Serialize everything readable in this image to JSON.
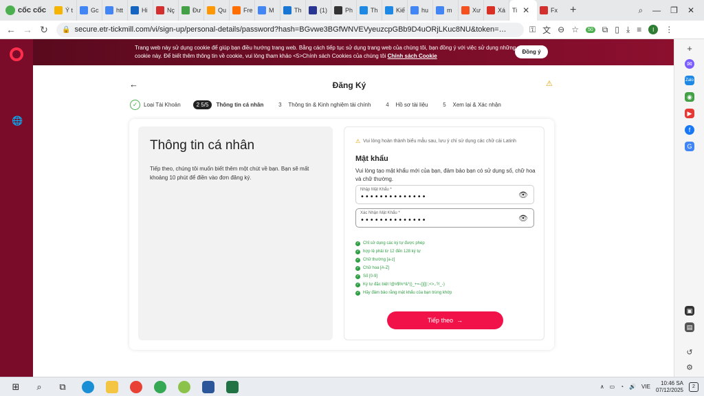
{
  "browser": {
    "name": "cốc cốc",
    "tabs": [
      {
        "label": "Ý t",
        "color": "#f4b400"
      },
      {
        "label": "Gc",
        "color": "#4285f4"
      },
      {
        "label": "htt",
        "color": "#4285f4"
      },
      {
        "label": "Hi",
        "color": "#1565c0"
      },
      {
        "label": "Nç",
        "color": "#d32f2f"
      },
      {
        "label": "Đư",
        "color": "#43a047"
      },
      {
        "label": "Qu",
        "color": "#ff9800"
      },
      {
        "label": "Fre",
        "color": "#ff6f00"
      },
      {
        "label": "M",
        "color": "#4285f4"
      },
      {
        "label": "Th",
        "color": "#1976d2"
      },
      {
        "label": "(1)",
        "color": "#283593"
      },
      {
        "label": "Ph",
        "color": "#333333"
      },
      {
        "label": "Th",
        "color": "#1e88e5"
      },
      {
        "label": "Kiế",
        "color": "#1e88e5"
      },
      {
        "label": "hu",
        "color": "#4285f4"
      },
      {
        "label": "m",
        "color": "#4285f4"
      },
      {
        "label": "Xư",
        "color": "#f4511e"
      },
      {
        "label": "Xá",
        "color": "#d93025"
      }
    ],
    "active_tab": "Ti",
    "tab_after": "Fx",
    "url": "secure.etr-tickmill.com/vi/sign-up/personal-details/password?hash=BGvwe3BGfWNVEVyeuzcpGBb9D4uORjLKuc8NU&token=aDMiWzPpuU0MGlGsWi...",
    "extension_badge": "50",
    "profile_initial": "I"
  },
  "cookie": {
    "text": "Trang web này sử dụng cookie để giúp bạn điều hướng trang web. Bằng cách tiếp tục sử dụng trang web của chúng tôi, bạn đồng ý với việc sử dụng những cookie này. Để biết thêm thông tin về cookie, vui lòng tham khảo <5>Chính sách Cookies của chúng tôi",
    "link": "Chính sách Cookie",
    "accept": "Đồng ý"
  },
  "page": {
    "title": "Đăng Ký",
    "steps": [
      {
        "num": "",
        "label": "Loại Tài Khoản",
        "state": "done"
      },
      {
        "num": "2",
        "extra": "5/5",
        "label": "Thông tin cá nhân",
        "state": "current"
      },
      {
        "num": "3",
        "label": "Thông tin & Kinh nghiệm tài chính",
        "state": "todo"
      },
      {
        "num": "4",
        "label": "Hồ sơ tài liệu",
        "state": "todo"
      },
      {
        "num": "5",
        "label": "Xem lại & Xác nhận",
        "state": "todo"
      }
    ],
    "left_title": "Thông tin cá nhân",
    "left_desc": "Tiếp theo, chúng tôi muốn biết thêm một chút về bạn. Bạn sẽ mất khoảng 10 phút để điền vào đơn đăng ký.",
    "notice": "Vui lòng hoàn thành biểu mẫu sau, lưu ý chỉ sử dụng các chữ cái Latinh",
    "section_title": "Mật khẩu",
    "section_desc": "Vui lòng tạo mật khẩu mới của bạn, đảm bảo bạn có sử dụng số, chữ hoa và chữ thường.",
    "password_label": "Nhập Mật Khẩu *",
    "password_value": "••••••••••••••",
    "confirm_label": "Xác Nhận Mật Khẩu *",
    "confirm_value": "••••••••••••••",
    "rules": [
      "Chỉ sử dụng các ký tự được phép",
      "hợp lệ phải từ 12 đến 128 ký tự",
      "Chữ thường [a-z]",
      "Chữ hoa [A-Z]",
      "Số [0-9]",
      "Ký tự đặc biệt !@#$%^&*()_+=-{}[]|:;<>,.?/_-)",
      "Hãy đảm bảo rằng mật khẩu của bạn trùng khớp"
    ],
    "next_button": "Tiếp theo"
  },
  "taskbar": {
    "lang": "VIE",
    "time": "10:46 SA",
    "date": "07/12/2025",
    "notif_count": "2"
  },
  "colors": {
    "brand_dark": "#7a0c2a",
    "accent": "#f2124a",
    "success": "#2e9e43"
  }
}
